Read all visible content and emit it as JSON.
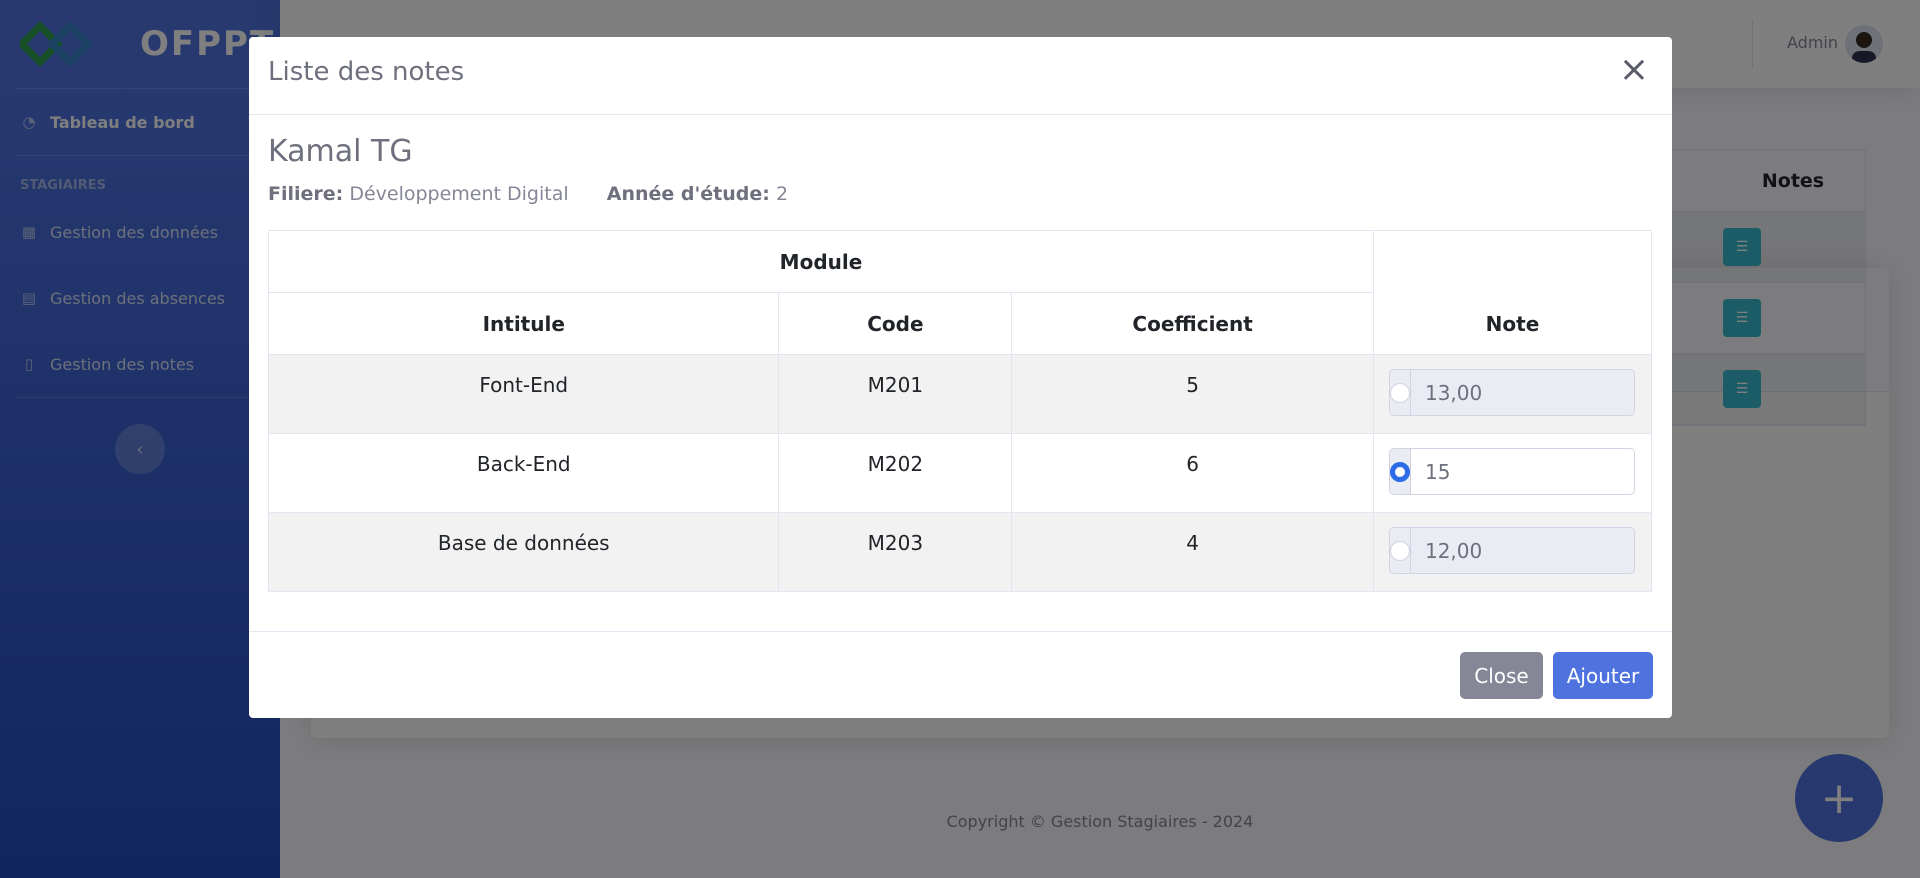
{
  "sidebar": {
    "brand": "OFPPT",
    "dashboard": "Tableau de bord",
    "section_heading": "STAGIAIRES",
    "items": [
      {
        "label": "Gestion des données"
      },
      {
        "label": "Gestion des absences"
      },
      {
        "label": "Gestion des notes"
      }
    ]
  },
  "topbar": {
    "user_name": "Admin"
  },
  "background_table": {
    "header": "Notes"
  },
  "footer": {
    "text": "Copyright © Gestion Stagiaires - 2024"
  },
  "modal": {
    "title": "Liste des notes",
    "close_icon": "×",
    "student_name": "Kamal TG",
    "filiere_label": "Filiere:",
    "filiere_value": "Développement Digital",
    "annee_label": "Année d'étude:",
    "annee_value": "2",
    "table": {
      "group_header": "Module",
      "columns": [
        "Intitule",
        "Code",
        "Coefficient",
        "Note"
      ],
      "rows": [
        {
          "intitule": "Font-End",
          "code": "M201",
          "coefficient": "5",
          "note": "13,00",
          "selected": false
        },
        {
          "intitule": "Back-End",
          "code": "M202",
          "coefficient": "6",
          "note": "15",
          "selected": true
        },
        {
          "intitule": "Base de données",
          "code": "M203",
          "coefficient": "4",
          "note": "12,00",
          "selected": false
        }
      ]
    },
    "buttons": {
      "close": "Close",
      "add": "Ajouter"
    }
  }
}
